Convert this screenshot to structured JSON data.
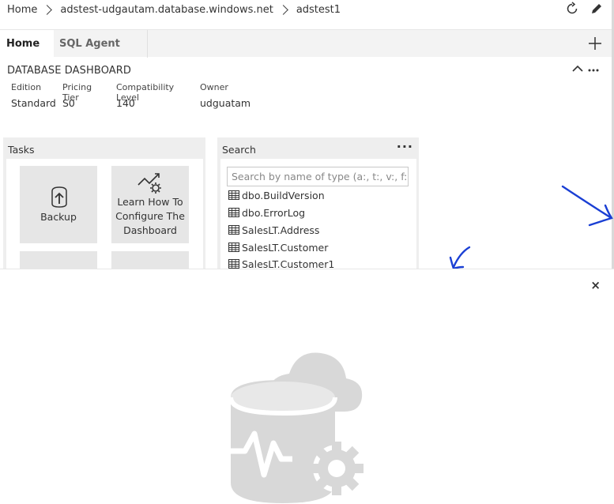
{
  "breadcrumb": [
    "Home",
    "adstest-udgautam.database.windows.net",
    "adstest1"
  ],
  "top_actions": {
    "refresh_icon": "refresh-icon",
    "edit_icon": "pencil-icon"
  },
  "tabs": [
    {
      "label": "Home",
      "active": true
    },
    {
      "label": "SQL Agent",
      "active": false
    }
  ],
  "add_tab_icon": "plus-icon",
  "dashboard": {
    "title": "DATABASE DASHBOARD",
    "properties": [
      {
        "key": "Edition",
        "value": "Standard"
      },
      {
        "key": "Pricing Tier",
        "value": "S0"
      },
      {
        "key": "Compatibility Level",
        "value": "140"
      },
      {
        "key": "Owner",
        "value": "udguatam"
      }
    ]
  },
  "tasks_widget": {
    "title": "Tasks",
    "tiles": [
      {
        "label": "Backup",
        "icon": "backup-icon"
      },
      {
        "label": "Learn How To Configure The Dashboard",
        "label_lines": [
          "Learn How To",
          "Configure The",
          "Dashboard"
        ],
        "icon": "chart-gear-icon"
      }
    ]
  },
  "search_widget": {
    "title": "Search",
    "more": "···",
    "placeholder": "Search by name of type (a:, t:, v:, f:, o...",
    "results": [
      "dbo.BuildVersion",
      "dbo.ErrorLog",
      "SalesLT.Address",
      "SalesLT.Customer",
      "SalesLT.Customer1"
    ]
  },
  "panel": {
    "close": "×",
    "illustration": "database-cloud-gear-icon"
  },
  "colors": {
    "annotation_blue": "#1a3fd4",
    "tile_gray": "#e6e6e6",
    "widget_gray": "#eeeeee",
    "illustration_gray": "#d8d8d8"
  }
}
